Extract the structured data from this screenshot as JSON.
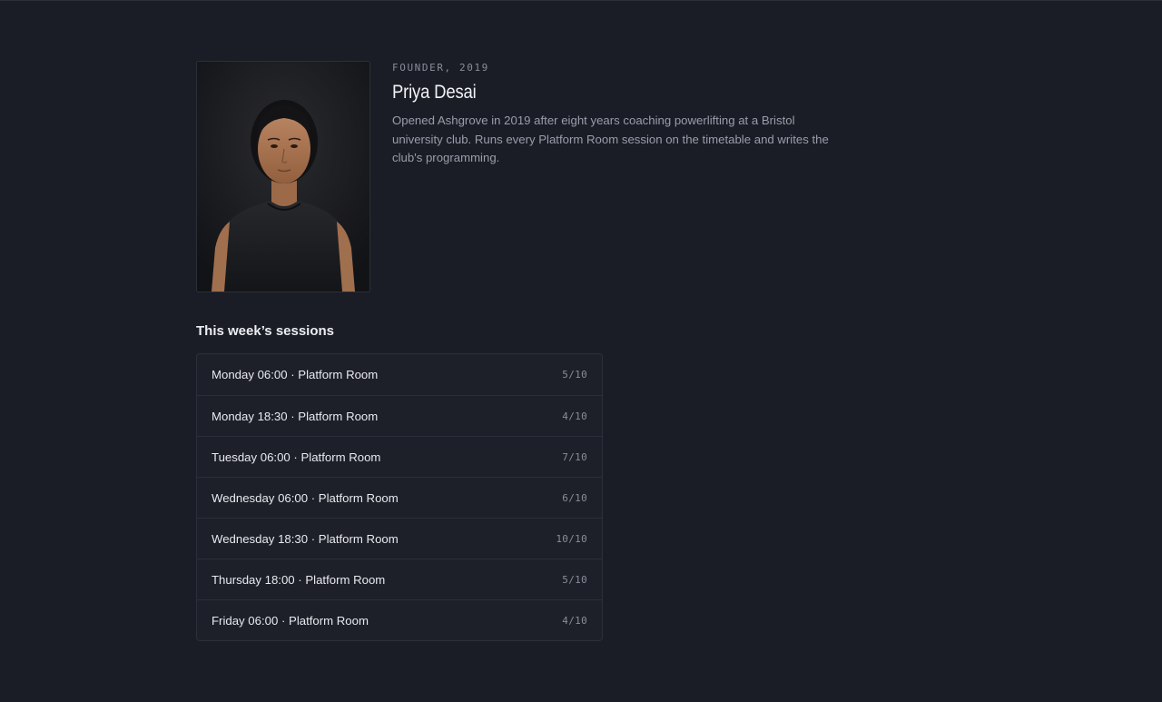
{
  "profile": {
    "eyebrow": "FOUNDER, 2019",
    "name": "Priya Desai",
    "bio": "Opened Ashgrove in 2019 after eight years coaching powerlifting at a Bristol university club. Runs every Platform Room session on the timetable and writes the club's programming."
  },
  "sessions": {
    "title": "This week’s sessions",
    "items": [
      {
        "label": "Monday 06:00 · Platform Room",
        "count": "5/10"
      },
      {
        "label": "Monday 18:30 · Platform Room",
        "count": "4/10"
      },
      {
        "label": "Tuesday 06:00 · Platform Room",
        "count": "7/10"
      },
      {
        "label": "Wednesday 06:00 · Platform Room",
        "count": "6/10"
      },
      {
        "label": "Wednesday 18:30 · Platform Room",
        "count": "10/10"
      },
      {
        "label": "Thursday 18:00 · Platform Room",
        "count": "5/10"
      },
      {
        "label": "Friday 06:00 · Platform Room",
        "count": "4/10"
      }
    ]
  },
  "colors": {
    "background": "#1b1d26",
    "border": "#2c2f3b",
    "muted_text": "#8a8d99"
  }
}
